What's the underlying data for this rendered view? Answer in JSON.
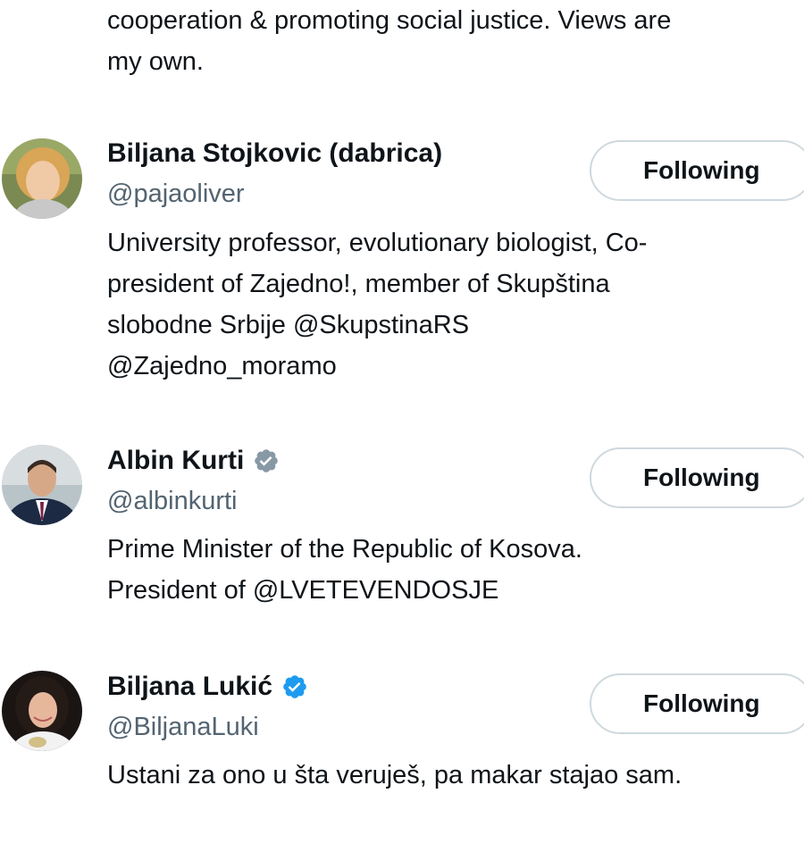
{
  "top_bio": {
    "text": "cooperation & promoting social justice. Views are\nmy own."
  },
  "users": [
    {
      "name": "Biljana Stojkovic (dabrica)",
      "verified": false,
      "handle": "@pajaoliver",
      "bio": "University professor, evolutionary biologist, Co-\npresident of Zajedno!, member of Skupština\nslobodne Srbije @SkupstinaRS\n@Zajedno_moramo",
      "button_label": "Following"
    },
    {
      "name": "Albin Kurti",
      "verified": true,
      "verified_color": "#8899a6",
      "handle": "@albinkurti",
      "bio": "Prime Minister of the Republic of Kosova.\nPresident of @LVETEVENDOSJE",
      "button_label": "Following"
    },
    {
      "name": "Biljana Lukić",
      "verified": true,
      "verified_color": "#1d9bf0",
      "handle": "@BiljanaLuki",
      "bio": "Ustani za ono u šta veruješ, pa makar stajao sam.",
      "button_label": "Following"
    }
  ],
  "colors": {
    "text_primary": "#0f1419",
    "text_secondary": "#536471",
    "button_border": "#cfd9de",
    "verified_blue": "#1d9bf0",
    "verified_gray": "#8899a6"
  }
}
